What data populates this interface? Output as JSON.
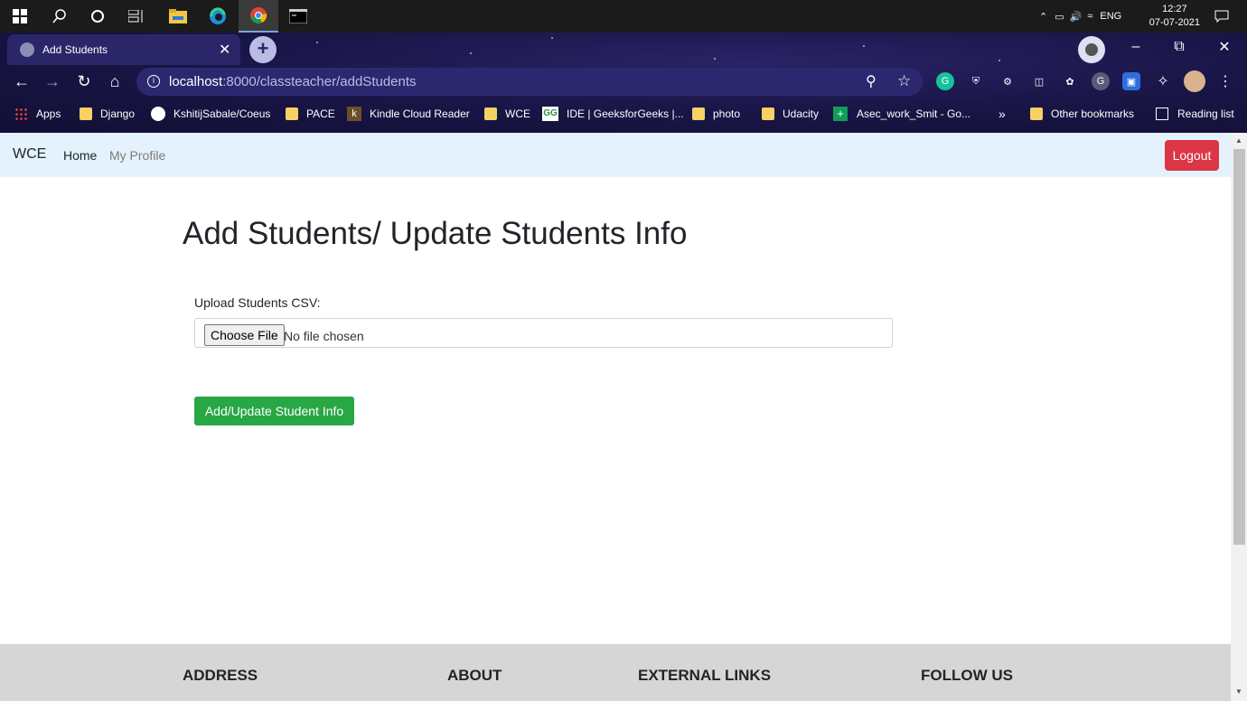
{
  "taskbar": {
    "icons": [
      "windows-icon",
      "search-icon",
      "cortana-icon",
      "task-view-icon",
      "file-explorer-icon",
      "edge-icon",
      "chrome-icon",
      "terminal-icon"
    ],
    "tray": {
      "language": "ENG",
      "time": "12:27",
      "date": "07-07-2021"
    }
  },
  "browser": {
    "tab_title": "Add Students",
    "url_host": "localhost",
    "url_path": ":8000/classteacher/addStudents",
    "bookmarks": [
      "Apps",
      "Django",
      "KshitijSabale/Coeus",
      "PACE",
      "Kindle Cloud Reader",
      "WCE",
      "IDE | GeeksforGeeks |...",
      "photo",
      "Udacity",
      "Asec_work_Smit - Go..."
    ],
    "more_bookmarks": "»",
    "other_bookmarks": "Other bookmarks",
    "reading_list": "Reading list"
  },
  "navbar": {
    "brand": "WCE",
    "home": "Home",
    "profile": "My Profile",
    "logout": "Logout"
  },
  "main": {
    "heading": "Add Students/ Update Students Info",
    "upload_label": "Upload Students CSV:",
    "choose_file": "Choose File",
    "no_file": "No file chosen",
    "submit": "Add/Update Student Info"
  },
  "footer": {
    "headings": [
      "ADDRESS",
      "ABOUT",
      "EXTERNAL LINKS",
      "FOLLOW US"
    ]
  },
  "colors": {
    "navbar_bg": "#e3f2fd",
    "logout_bg": "#dc3545",
    "submit_bg": "#28a745",
    "footer_bg": "#d6d6d6"
  }
}
